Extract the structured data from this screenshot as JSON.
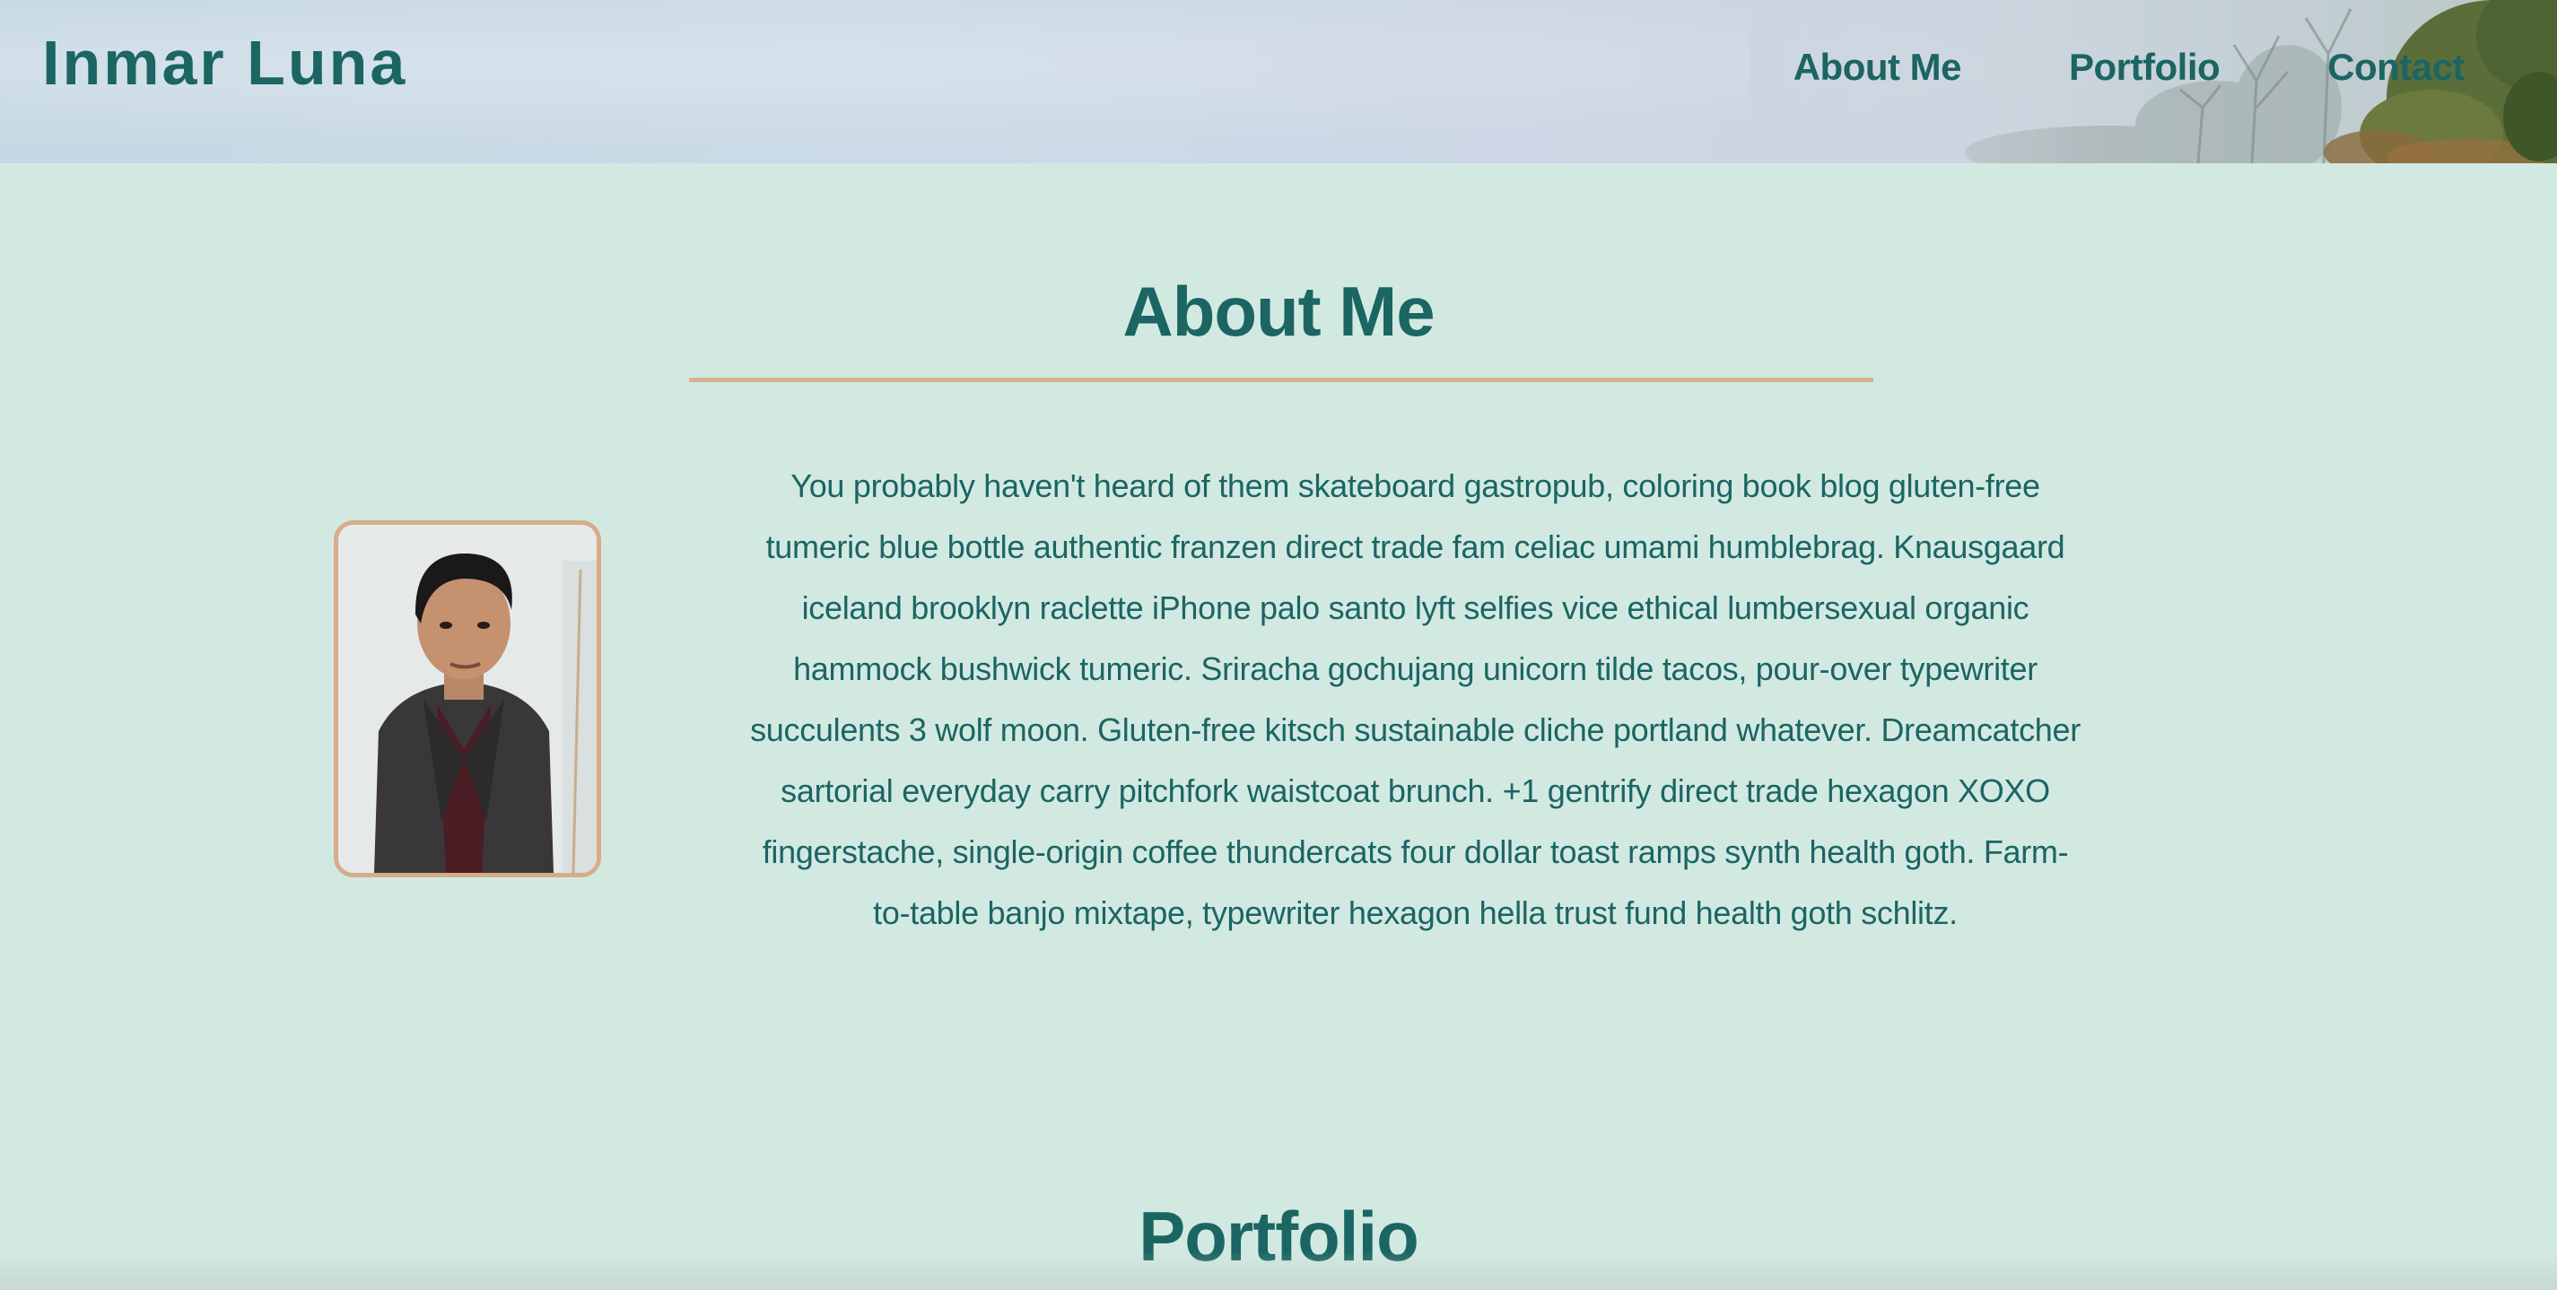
{
  "header": {
    "brand": "Inmar Luna",
    "nav": [
      {
        "label": "About Me"
      },
      {
        "label": "Portfolio"
      },
      {
        "label": "Contact"
      }
    ]
  },
  "about": {
    "title": "About Me",
    "bio": "You probably haven't heard of them skateboard gastropub, coloring book blog gluten-free tumeric blue bottle authentic franzen direct trade fam celiac umami humblebrag. Knausgaard iceland brooklyn raclette iPhone palo santo lyft selfies vice ethical lumbersexual organic hammock bushwick tumeric. Sriracha gochujang unicorn tilde tacos, pour-over typewriter succulents 3 wolf moon. Gluten-free kitsch sustainable cliche portland whatever. Dreamcatcher sartorial everyday carry pitchfork waistcoat brunch. +1 gentrify direct trade hexagon XOXO fingerstache, single-origin coffee thundercats four dollar toast ramps synth health goth. Farm-to-table banjo mixtape, typewriter hexagon hella trust fund health goth schlitz."
  },
  "portfolio": {
    "title": "Portfolio"
  },
  "colors": {
    "accent": "#1b6563",
    "background": "#d2e9e2",
    "divider": "#d8b190"
  }
}
